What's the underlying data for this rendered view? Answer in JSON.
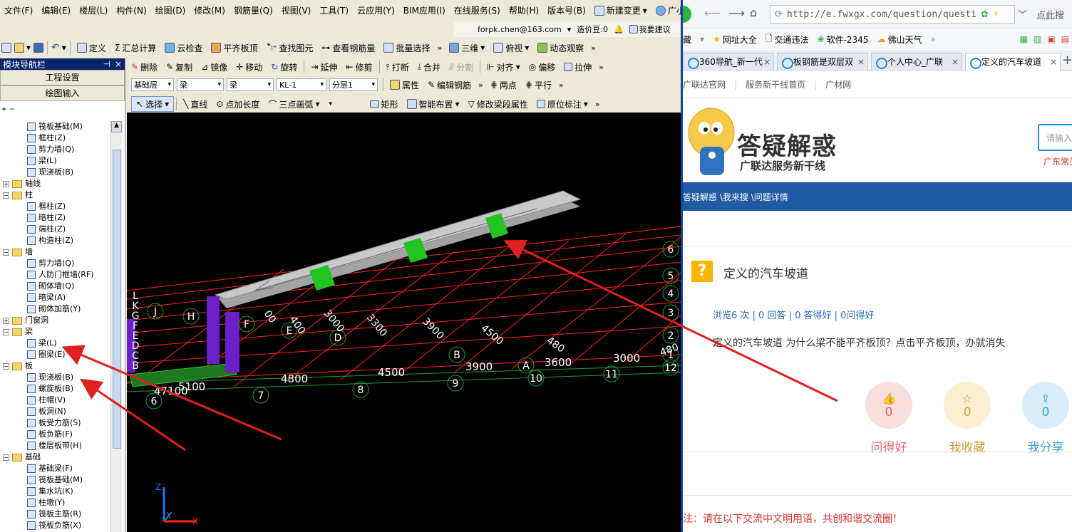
{
  "menu": [
    "文件(F)",
    "编辑(E)",
    "楼层(L)",
    "构件(N)",
    "绘图(D)",
    "修改(M)",
    "钢筋量(Q)",
    "视图(V)",
    "工具(T)",
    "云应用(Y)",
    "BIM应用(I)",
    "在线服务(S)",
    "帮助(H)",
    "版本号(B)",
    "新建变更",
    "广小二"
  ],
  "account": {
    "email": "forpk.chen@163.com",
    "price": "造价豆:0",
    "ask": "我要建议"
  },
  "toolbar1": [
    "定义",
    "汇总计算",
    "云检查",
    "平齐板顶",
    "查找图元",
    "查看钢筋量",
    "批量选择",
    "三维",
    "俯视",
    "动态观察"
  ],
  "toolbar2": [
    "删除",
    "复制",
    "镜像",
    "移动",
    "旋转",
    "延伸",
    "修剪",
    "打断",
    "合并",
    "分割",
    "对齐",
    "偏移",
    "拉伸"
  ],
  "toolbar3": {
    "floor": "基础层",
    "type1": "梁",
    "type2": "梁",
    "member": "KL-1",
    "layer": "分层1",
    "items": [
      "属性",
      "编辑钢筋",
      "两点",
      "平行"
    ]
  },
  "toolbar4": [
    "选择",
    "直线",
    "点加长度",
    "三点画弧",
    "矩形",
    "智能布置",
    "修改梁段属性",
    "原位标注"
  ],
  "nav": {
    "title": "模块导航栏",
    "pin": "ᵖ",
    "close": "×",
    "btn1": "工程设置",
    "btn2": "绘图输入",
    "tree": [
      {
        "level": 2,
        "kind": "leaf",
        "label": "筏板基础(M)"
      },
      {
        "level": 2,
        "kind": "leaf",
        "label": "框柱(Z)"
      },
      {
        "level": 2,
        "kind": "leaf",
        "label": "剪力墙(Q)"
      },
      {
        "level": 2,
        "kind": "leaf",
        "label": "梁(L)"
      },
      {
        "level": 2,
        "kind": "leaf",
        "label": "现浇板(B)"
      },
      {
        "level": 1,
        "kind": "folder",
        "exp": "+",
        "label": "轴线"
      },
      {
        "level": 1,
        "kind": "folder",
        "exp": "−",
        "label": "柱"
      },
      {
        "level": 2,
        "kind": "leaf",
        "label": "框柱(Z)"
      },
      {
        "level": 2,
        "kind": "leaf",
        "label": "暗柱(Z)"
      },
      {
        "level": 2,
        "kind": "leaf",
        "label": "端柱(Z)"
      },
      {
        "level": 2,
        "kind": "leaf",
        "label": "构造柱(Z)"
      },
      {
        "level": 1,
        "kind": "folder",
        "exp": "−",
        "label": "墙"
      },
      {
        "level": 2,
        "kind": "leaf",
        "label": "剪力墙(Q)"
      },
      {
        "level": 2,
        "kind": "leaf",
        "label": "人防门框墙(RF)"
      },
      {
        "level": 2,
        "kind": "leaf",
        "label": "砌体墙(Q)"
      },
      {
        "level": 2,
        "kind": "leaf",
        "label": "暗梁(A)"
      },
      {
        "level": 2,
        "kind": "leaf",
        "label": "砌体加筋(Y)"
      },
      {
        "level": 1,
        "kind": "folder",
        "exp": "+",
        "label": "门窗洞"
      },
      {
        "level": 1,
        "kind": "folder",
        "exp": "−",
        "label": "梁"
      },
      {
        "level": 2,
        "kind": "leaf",
        "label": "梁(L)"
      },
      {
        "level": 2,
        "kind": "leaf",
        "label": "圈梁(E)"
      },
      {
        "level": 1,
        "kind": "folder",
        "exp": "−",
        "label": "板"
      },
      {
        "level": 2,
        "kind": "leaf",
        "label": "现浇板(B)"
      },
      {
        "level": 2,
        "kind": "leaf",
        "label": "螺旋板(B)"
      },
      {
        "level": 2,
        "kind": "leaf",
        "label": "柱帽(V)"
      },
      {
        "level": 2,
        "kind": "leaf",
        "label": "板洞(N)"
      },
      {
        "level": 2,
        "kind": "leaf",
        "label": "板受力筋(S)"
      },
      {
        "level": 2,
        "kind": "leaf",
        "label": "板负筋(F)"
      },
      {
        "level": 2,
        "kind": "leaf",
        "label": "楼层板带(H)"
      },
      {
        "level": 1,
        "kind": "folder",
        "exp": "−",
        "label": "基础"
      },
      {
        "level": 2,
        "kind": "leaf",
        "label": "基础梁(F)"
      },
      {
        "level": 2,
        "kind": "leaf",
        "label": "筏板基础(M)"
      },
      {
        "level": 2,
        "kind": "leaf",
        "label": "集水坑(K)"
      },
      {
        "level": 2,
        "kind": "leaf",
        "label": "柱墩(Y)"
      },
      {
        "level": 2,
        "kind": "leaf",
        "label": "筏板主筋(R)"
      },
      {
        "level": 2,
        "kind": "leaf",
        "label": "筏板负筋(X)"
      }
    ]
  },
  "canvas": {
    "dims_bottom": [
      "5100",
      "4800",
      "4500",
      "3900",
      "3600",
      "3000",
      "47100"
    ],
    "dims_diag": [
      "400",
      "3000",
      "3300",
      "3900",
      "4500",
      "480",
      "480",
      "00"
    ],
    "axes_num": [
      "6",
      "7",
      "8",
      "9",
      "10",
      "11",
      "12",
      "1",
      "2",
      "3",
      "4",
      "5",
      "6"
    ],
    "axes_letter": [
      "J",
      "H",
      "F",
      "E",
      "D",
      "B",
      "A",
      "L",
      "K",
      "G",
      "F",
      "E",
      "D",
      "C",
      "B"
    ],
    "axis_labels": [
      "Z",
      "Y",
      "X"
    ]
  },
  "browser": {
    "url": "http://e.fwxgx.com/question/questi",
    "right_link": "点此搜",
    "bookmarks": [
      "藏",
      "网址大全",
      "交通违法",
      "软件-2345",
      "佛山天气"
    ],
    "tabs": [
      "360导航_新一代",
      "板钢筋是双层双",
      "个人中心_广联",
      "定义的汽车坡道"
    ],
    "sitenav": [
      "广联达官网",
      "服务新干线首页",
      "广材网"
    ],
    "logo_title": "答疑解惑",
    "logo_sub": "广联达服务新干线",
    "search_placeholder": "请输入关",
    "search_hint": "广东常见",
    "breadcrumb": "答疑解惑 \\我来搜 \\问题详情",
    "question_title": "定义的汽车坡道",
    "stats": "浏览6 次 | 0 回答 | 0 答得好 | 0问得好",
    "question_body": "定义的汽车坡道 为什么梁不能平齐板顶？点击平齐板顶，办就消失",
    "actions": [
      {
        "label": "问得好",
        "count": "0",
        "color": "#e06a6a",
        "bg": "#f9dede"
      },
      {
        "label": "我收藏",
        "count": "0",
        "color": "#c9a03a",
        "bg": "#fbeed2"
      },
      {
        "label": "我分享",
        "count": "0",
        "color": "#3aa1d9",
        "bg": "#d8eef9"
      }
    ],
    "notice": "注：请在以下交流中文明用语，共创和谐交流圈！"
  }
}
